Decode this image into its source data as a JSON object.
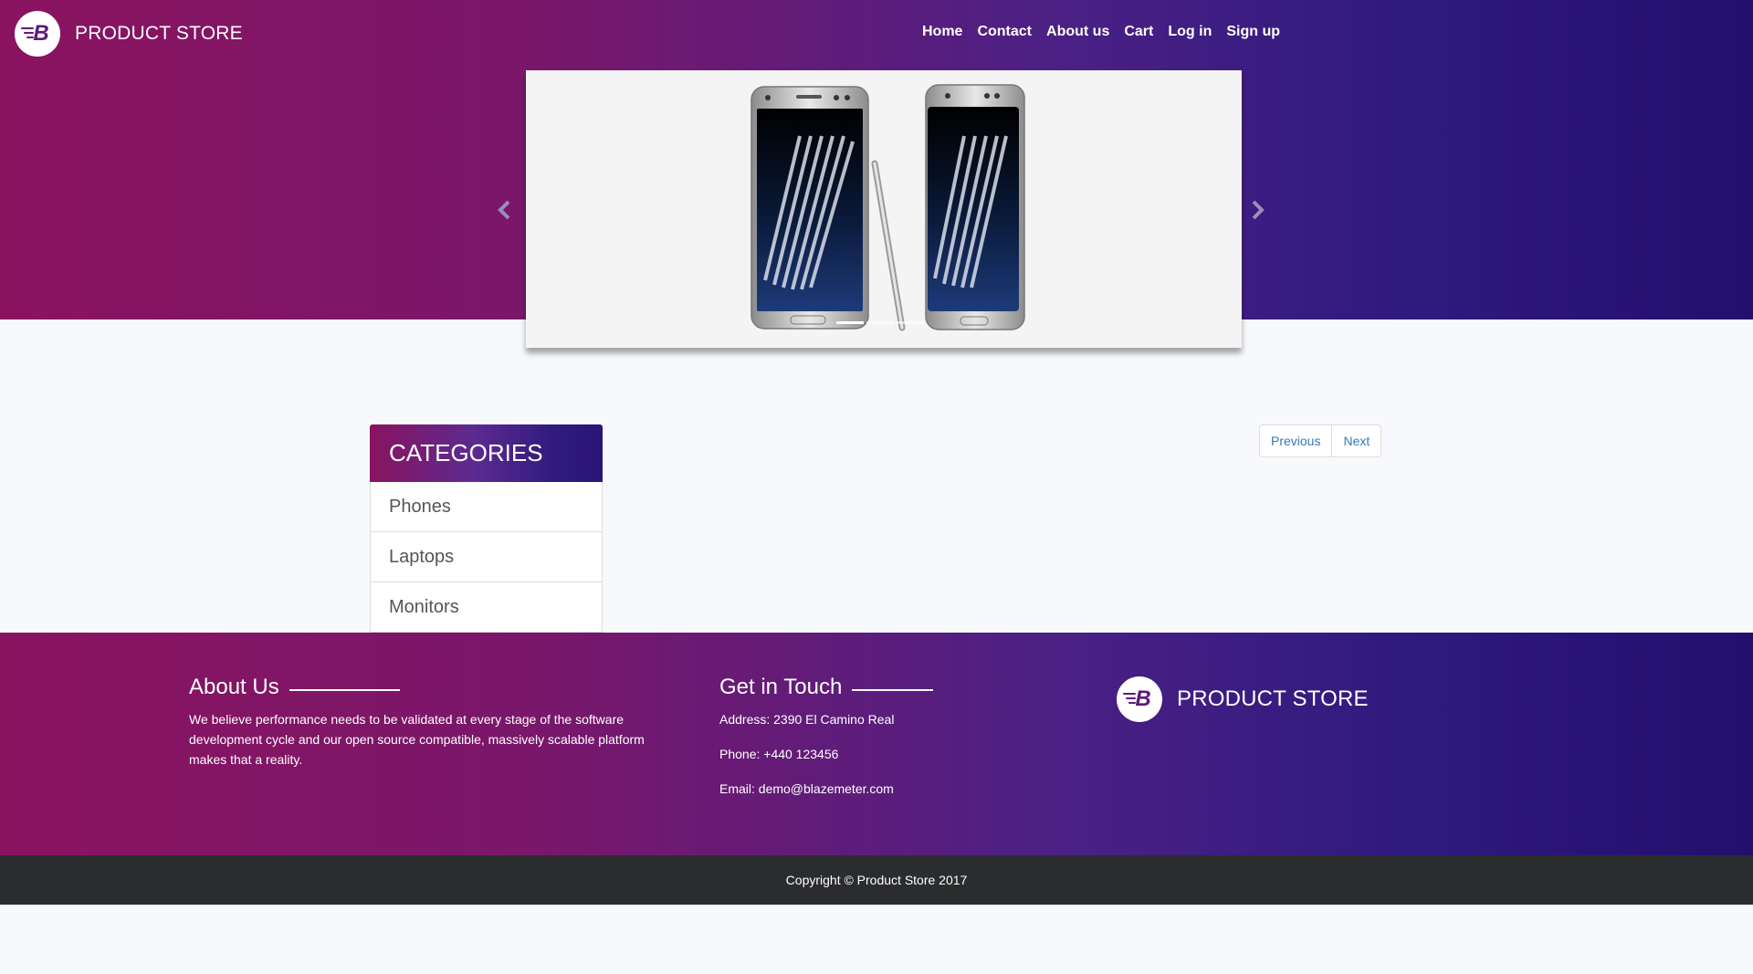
{
  "brand": {
    "name": "PRODUCT STORE",
    "logo_letter": "B"
  },
  "nav": {
    "items": [
      {
        "label": "Home"
      },
      {
        "label": "Contact"
      },
      {
        "label": "About us"
      },
      {
        "label": "Cart"
      },
      {
        "label": "Log in"
      },
      {
        "label": "Sign up"
      }
    ]
  },
  "carousel": {
    "prev_icon": "chevron-left-icon",
    "next_icon": "chevron-right-icon",
    "slide_count": 3,
    "active_index": 0
  },
  "categories": {
    "title": "CATEGORIES",
    "items": [
      {
        "label": "Phones"
      },
      {
        "label": "Laptops"
      },
      {
        "label": "Monitors"
      }
    ]
  },
  "pagination": {
    "previous_label": "Previous",
    "next_label": "Next"
  },
  "footer": {
    "about": {
      "title": "About Us",
      "text": "We believe performance needs to be validated at every stage of the software development cycle and our open source compatible, massively scalable platform makes that a reality."
    },
    "contact": {
      "title": "Get in Touch",
      "address": "Address: 2390 El Camino Real",
      "phone": "Phone: +440 123456",
      "email": "Email: demo@blazemeter.com"
    },
    "brand_name": "PRODUCT STORE"
  },
  "copyright": "Copyright © Product Store 2017",
  "colors": {
    "gradient_start": "#8a1360",
    "gradient_end": "#230f6d",
    "link": "#337ab7",
    "copyright_bg": "#2b2c2e"
  }
}
